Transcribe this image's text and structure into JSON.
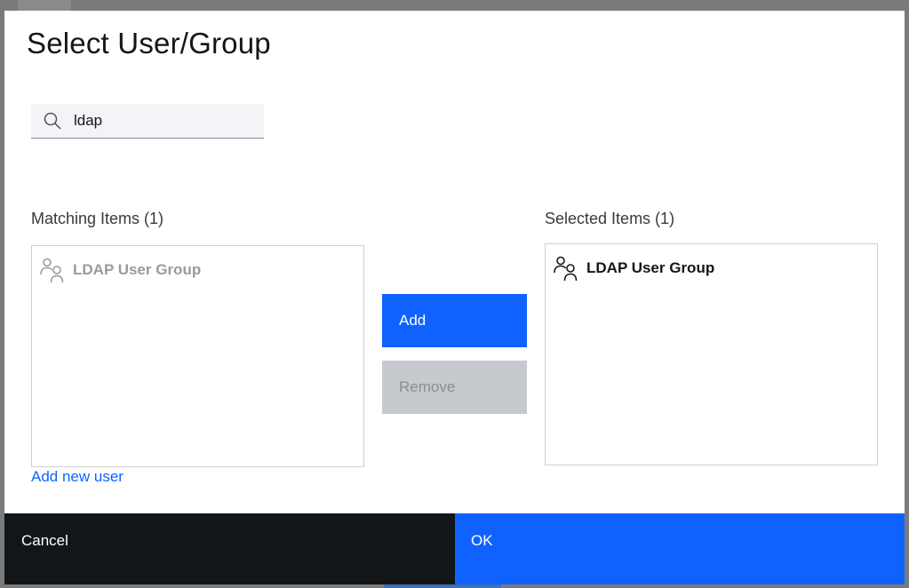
{
  "dialog": {
    "title": "Select User/Group"
  },
  "search": {
    "value": "ldap",
    "icon": "search-icon"
  },
  "matching": {
    "label": "Matching Items (1)",
    "items": [
      {
        "label": "LDAP User Group",
        "icon": "user-group-icon"
      }
    ]
  },
  "selected": {
    "label": "Selected Items (1)",
    "items": [
      {
        "label": "LDAP User Group",
        "icon": "user-group-icon"
      }
    ]
  },
  "actions": {
    "add_label": "Add",
    "remove_label": "Remove"
  },
  "links": {
    "add_new_user": "Add new user"
  },
  "footer": {
    "cancel_label": "Cancel",
    "ok_label": "OK"
  },
  "colors": {
    "primary": "#0f62fe",
    "footer_dark": "#121619",
    "disabled": "#c6c9ce"
  }
}
